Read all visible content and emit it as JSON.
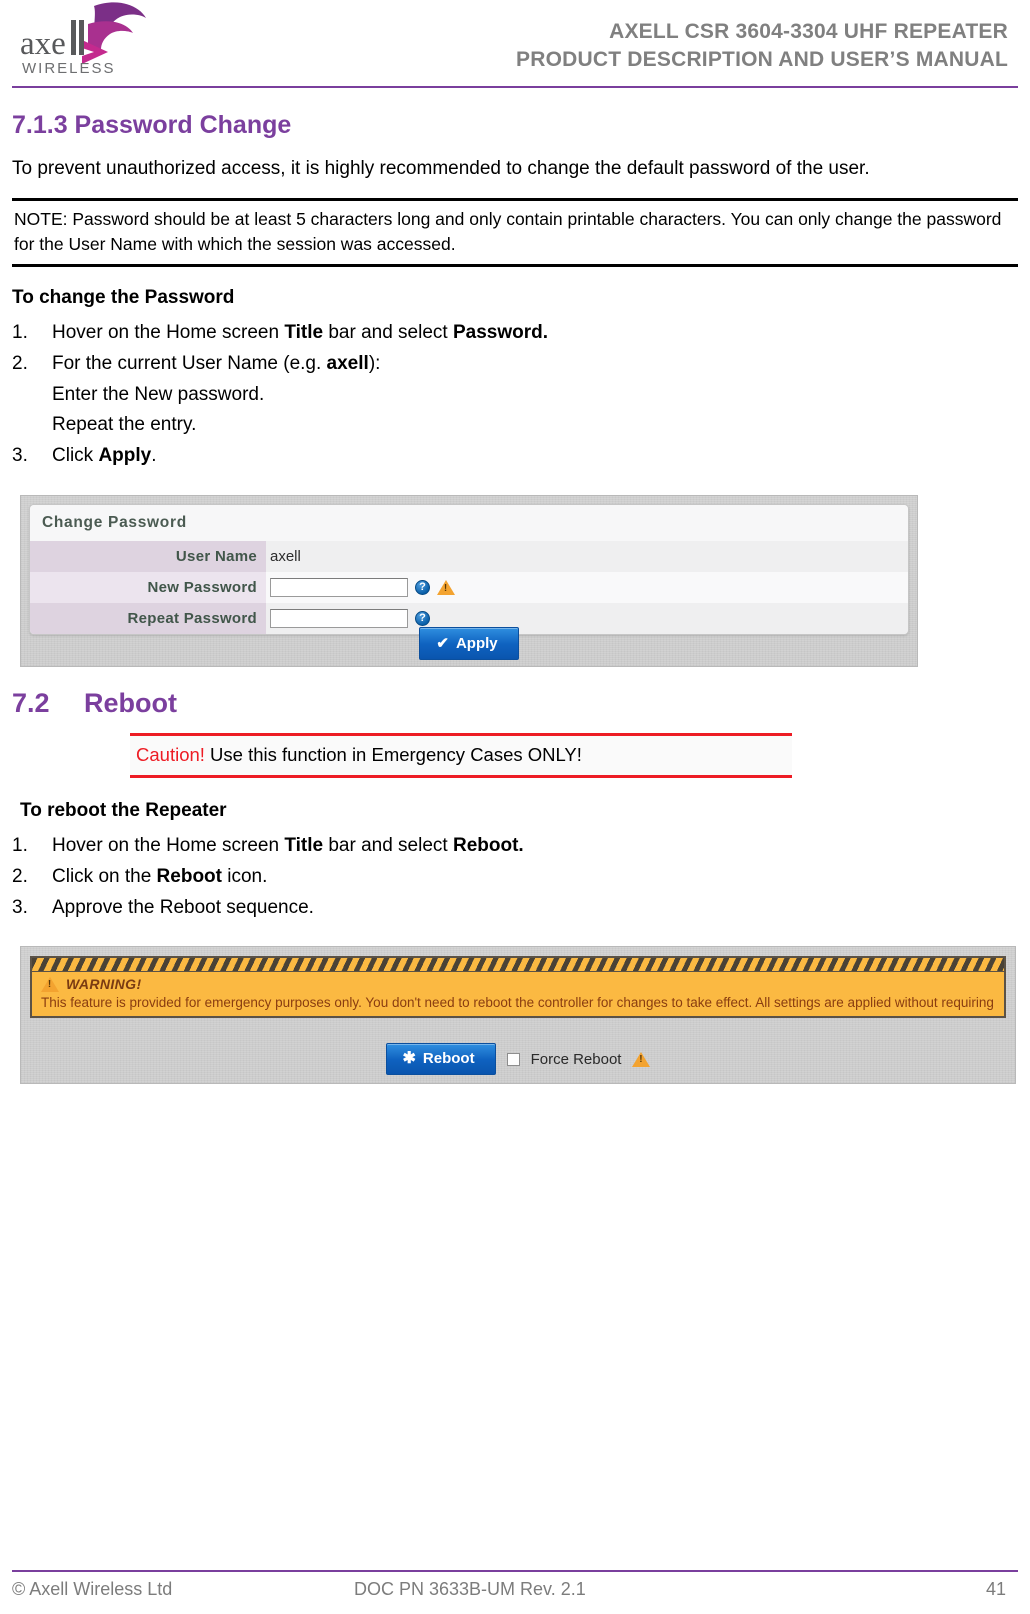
{
  "header": {
    "logo_word": "axell",
    "logo_sub": "WIRELESS",
    "title_line1": "AXELL CSR 3604-3304 UHF REPEATER",
    "title_line2": "PRODUCT DESCRIPTION AND USER’S MANUAL",
    "rule_color": "#7a3f9d",
    "title_color": "#808080"
  },
  "section_password": {
    "heading": "7.1.3 Password Change",
    "heading_color": "#7b3f9e",
    "intro": "To prevent unauthorized access, it is highly recommended to change the default password of the user.",
    "note": "NOTE: Password should be at least 5 characters long and only contain printable characters. You can only change the password for the User Name with which the session was accessed.",
    "procedure_title": "To change the Password",
    "steps": [
      {
        "marker": "1.",
        "parts": [
          {
            "text": "Hover on the Home screen ",
            "bold": false
          },
          {
            "text": "Title",
            "bold": true
          },
          {
            "text": " bar and select ",
            "bold": false
          },
          {
            "text": "Password.",
            "bold": true
          }
        ]
      },
      {
        "marker": "2.",
        "parts": [
          {
            "text": "For the current User Name (e.g. ",
            "bold": false
          },
          {
            "text": "axell",
            "bold": true
          },
          {
            "text": "):",
            "bold": false
          }
        ]
      }
    ],
    "substeps": [
      "Enter the New password.",
      "Repeat the entry."
    ],
    "step3": {
      "marker": "3.",
      "parts": [
        {
          "text": "Click ",
          "bold": false
        },
        {
          "text": "Apply",
          "bold": true
        },
        {
          "text": ".",
          "bold": false
        }
      ]
    }
  },
  "password_screenshot": {
    "panel_title": "Change Password",
    "rows": [
      {
        "label": "User Name",
        "value": "axell",
        "type": "static",
        "help": false,
        "warn": false
      },
      {
        "label": "New Password",
        "value": "",
        "type": "input",
        "help": true,
        "warn": true
      },
      {
        "label": "Repeat Password",
        "value": "",
        "type": "input",
        "help": true,
        "warn": false
      }
    ],
    "apply_label": "Apply",
    "help_glyph": "?",
    "label_col_bg": "#ded3e0",
    "button_color": "#0f62c0"
  },
  "section_reboot": {
    "number": "7.2",
    "heading": "Reboot",
    "caution_word": "Caution!",
    "caution_text": " Use this function in Emergency Cases ONLY!",
    "caution_color": "#ed1c24",
    "procedure_title": "To reboot the Repeater",
    "steps": [
      {
        "marker": "1.",
        "parts": [
          {
            "text": "Hover on the Home screen ",
            "bold": false
          },
          {
            "text": "Title",
            "bold": true
          },
          {
            "text": " bar and select ",
            "bold": false
          },
          {
            "text": "Reboot.",
            "bold": true
          }
        ]
      },
      {
        "marker": "2.",
        "parts": [
          {
            "text": "Click on the ",
            "bold": false
          },
          {
            "text": "Reboot",
            "bold": true
          },
          {
            "text": " icon.",
            "bold": false
          }
        ]
      },
      {
        "marker": "3.",
        "parts": [
          {
            "text": "Approve the Reboot sequence.",
            "bold": false
          }
        ]
      }
    ]
  },
  "reboot_screenshot": {
    "warning_label": "WARNING!",
    "warning_body": "This feature is provided for emergency purposes only. You don't need to reboot the controller for changes to take effect. All settings are applied without requiring to reboot the controller.",
    "reboot_label": "Reboot",
    "force_reboot_label": "Force Reboot",
    "force_reboot_checked": false,
    "warn_bg": "#fbb942",
    "warn_text_color": "#8a3d10"
  },
  "footer": {
    "copyright": "© Axell Wireless Ltd",
    "doc_id": "DOC PN 3633B-UM Rev. 2.1",
    "page_number": "41",
    "rule_color": "#7a3f9d"
  }
}
